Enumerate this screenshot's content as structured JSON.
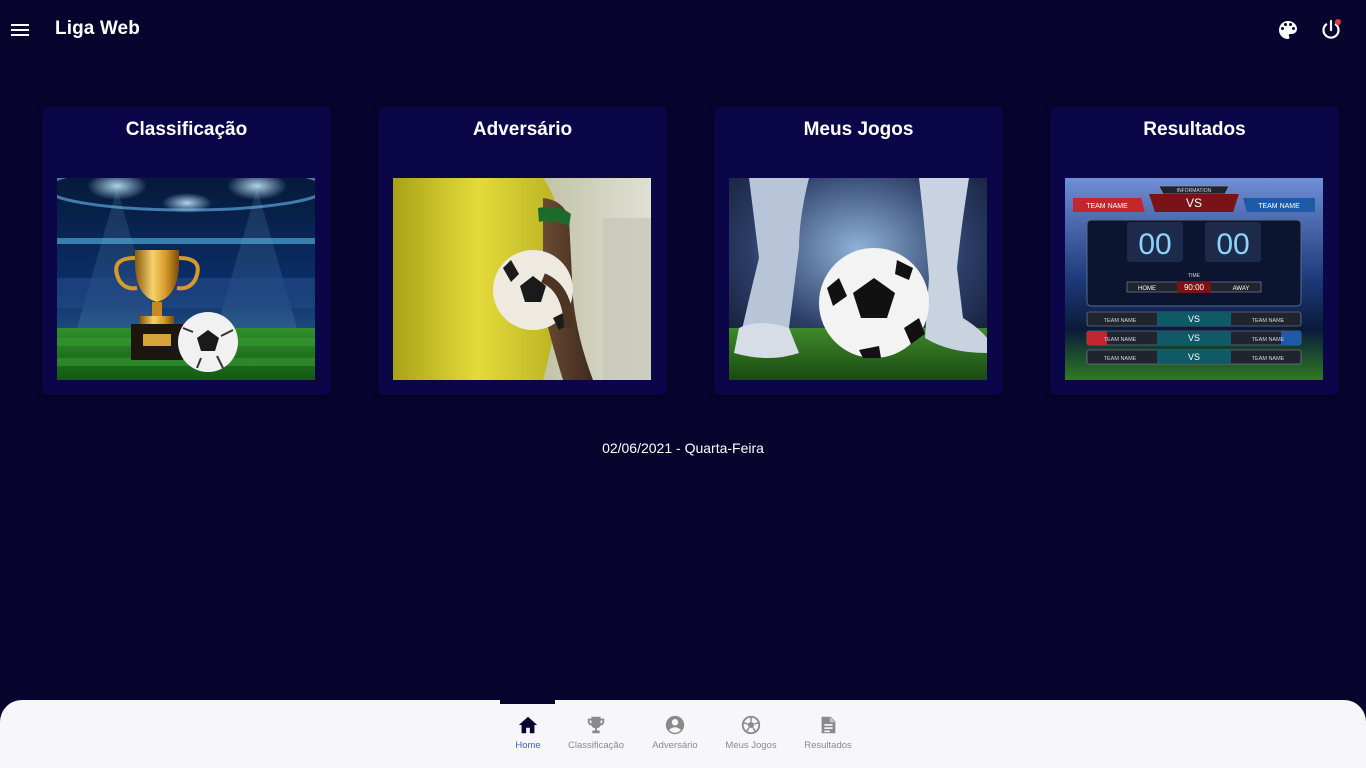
{
  "header": {
    "title": "Liga Web",
    "menu_icon": "menu-icon",
    "palette_icon": "palette-icon",
    "power_icon": "power-icon",
    "power_badge_color": "#e53935"
  },
  "cards": [
    {
      "title": "Classificação",
      "image": "trophy-stadium-image"
    },
    {
      "title": "Adversário",
      "image": "player-with-ball-image"
    },
    {
      "title": "Meus Jogos",
      "image": "kicking-ball-image"
    },
    {
      "title": "Resultados",
      "image": "scoreboard-image"
    }
  ],
  "scoreboard": {
    "info": "INFORMATION",
    "vs": "VS",
    "team_name": "TEAM NAME",
    "score_home": "00",
    "score_away": "00",
    "time_label": "TIME",
    "time_value": "90:00",
    "home": "HOME",
    "away": "AWAY"
  },
  "date_text": "02/06/2021 - Quarta-Feira",
  "bottom_nav": {
    "items": [
      {
        "label": "Home",
        "icon": "home-icon",
        "active": true
      },
      {
        "label": "Classificação",
        "icon": "trophy-icon",
        "active": false
      },
      {
        "label": "Adversário",
        "icon": "account-icon",
        "active": false
      },
      {
        "label": "Meus Jogos",
        "icon": "soccer-ball-icon",
        "active": false
      },
      {
        "label": "Resultados",
        "icon": "document-icon",
        "active": false
      }
    ]
  },
  "colors": {
    "background": "#07042e",
    "card": "#0b0647",
    "nav_active": "#3a63c8",
    "nav_inactive": "#8a8a8a"
  }
}
